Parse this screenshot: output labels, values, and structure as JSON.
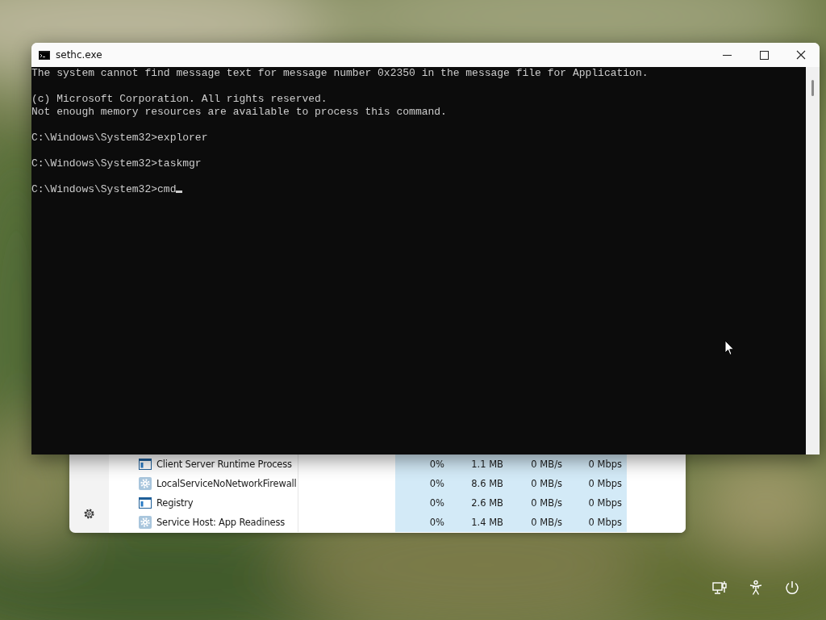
{
  "console": {
    "title": "sethc.exe",
    "blocks": [
      [
        "The system cannot find message text for message number 0x2350 in the message file for Application."
      ],
      [
        "(c) Microsoft Corporation. All rights reserved.",
        "Not enough memory resources are available to process this command."
      ],
      [
        "C:\\Windows\\System32>explorer"
      ],
      [
        "C:\\Windows\\System32>taskmgr"
      ],
      [
        "C:\\Windows\\System32>cmd"
      ]
    ],
    "cursor": true
  },
  "task_manager": {
    "rows": [
      {
        "name": "Client Server Runtime Process",
        "kind": "window",
        "cpu": "0%",
        "memory": "1.1 MB",
        "disk": "0 MB/s",
        "network": "0 Mbps"
      },
      {
        "name": "LocalServiceNoNetworkFirewall",
        "kind": "gear",
        "cpu": "0%",
        "memory": "8.6 MB",
        "disk": "0 MB/s",
        "network": "0 Mbps"
      },
      {
        "name": "Registry",
        "kind": "window",
        "cpu": "0%",
        "memory": "2.6 MB",
        "disk": "0 MB/s",
        "network": "0 Mbps"
      },
      {
        "name": "Service Host: App Readiness",
        "kind": "gear",
        "cpu": "0%",
        "memory": "1.4 MB",
        "disk": "0 MB/s",
        "network": "0 Mbps"
      }
    ]
  },
  "lock_screen": {
    "buttons": [
      {
        "kind": "network"
      },
      {
        "kind": "accessibility"
      },
      {
        "kind": "power"
      }
    ]
  }
}
